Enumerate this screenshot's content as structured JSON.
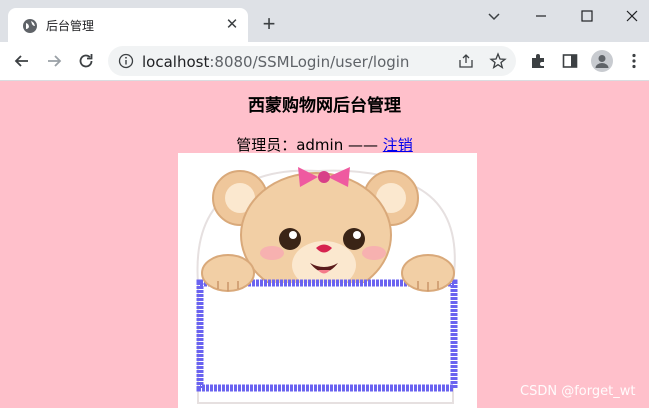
{
  "browser": {
    "tab_title": "后台管理",
    "url_host": "localhost",
    "url_path": ":8080/SSMLogin/user/login"
  },
  "page": {
    "title": "西蒙购物网后台管理",
    "admin_label": "管理员：",
    "admin_name": "admin",
    "separator": " —— ",
    "logout_link": "注销"
  },
  "watermark": "CSDN @forget_wt",
  "colors": {
    "page_background": "#ffc0cb",
    "link": "#0000ee",
    "sign_border": "#6a63f0"
  }
}
